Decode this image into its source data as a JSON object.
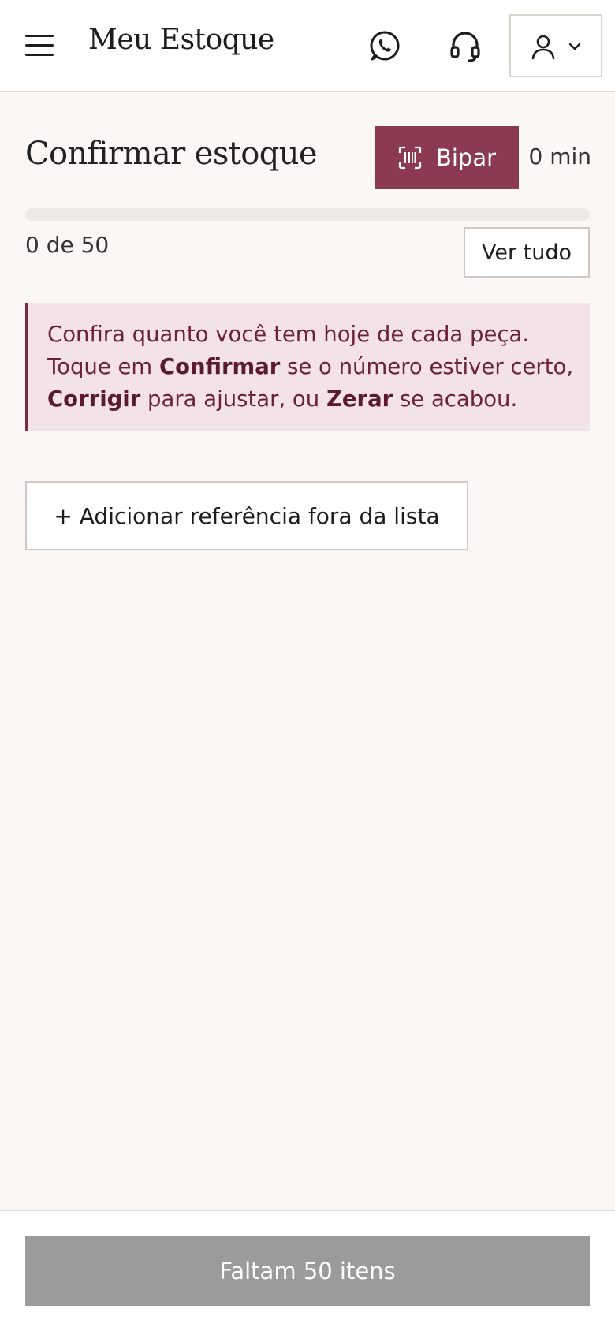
{
  "header": {
    "title": "Meu Estoque",
    "icons": {
      "menu": "menu-icon",
      "whatsapp": "whatsapp-icon",
      "support": "headset-icon",
      "user": "user-icon",
      "dropdown": "chevron-down-icon"
    }
  },
  "main": {
    "title": "Confirmar estoque",
    "scan_button": {
      "label": "Bipar",
      "icon": "barcode-scan-icon"
    },
    "timer": "0 min",
    "progress": {
      "label": "0 de 50",
      "done": 0,
      "total": 50,
      "fraction": 0
    },
    "see_all_label": "Ver tudo",
    "info": {
      "part1": "Confira quanto você tem hoje de cada peça. Toque em ",
      "bold1": "Confirmar",
      "part2": " se o número estiver certo, ",
      "bold2": "Corrigir",
      "part3": " para ajustar, ou ",
      "bold3": "Zerar",
      "part4": " se acabou."
    },
    "add_reference_label": "+ Adicionar referência fora da lista"
  },
  "footer": {
    "button_label": "Faltam 50 itens"
  },
  "colors": {
    "accent": "#8b3a52",
    "background": "#fbf7f4",
    "info_bg": "#f3e3e6",
    "disabled": "#9b9b9b"
  }
}
